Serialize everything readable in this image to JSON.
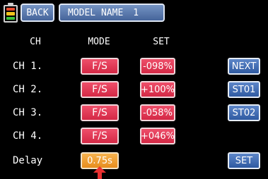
{
  "colors": {
    "background": "#000000",
    "mode_button": "#e03856",
    "delay_button": "#f0a03a",
    "nav_button": "#4a74b8",
    "header_button": "#5a7ab0",
    "pointer": "#e83030"
  },
  "battery": {
    "icon": "battery-icon",
    "level_fraction": 1.0
  },
  "header": {
    "back_label": "BACK",
    "model_label": "MODEL NAME",
    "model_number": "1"
  },
  "columns": {
    "ch": "CH",
    "mode": "MODE",
    "set": "SET"
  },
  "rows": [
    {
      "label": "CH 1.",
      "mode": "F/S",
      "set": "-098%"
    },
    {
      "label": "CH 2.",
      "mode": "F/S",
      "set": "+100%"
    },
    {
      "label": "CH 3.",
      "mode": "F/S",
      "set": "-058%"
    },
    {
      "label": "CH 4.",
      "mode": "F/S",
      "set": "+046%"
    }
  ],
  "delay": {
    "label": "Delay",
    "value": "0.75s"
  },
  "side_buttons": {
    "next": "NEXT",
    "st01": "ST01",
    "st02": "ST02",
    "set": "SET"
  },
  "pointer": {
    "icon": "up-arrow-icon"
  }
}
